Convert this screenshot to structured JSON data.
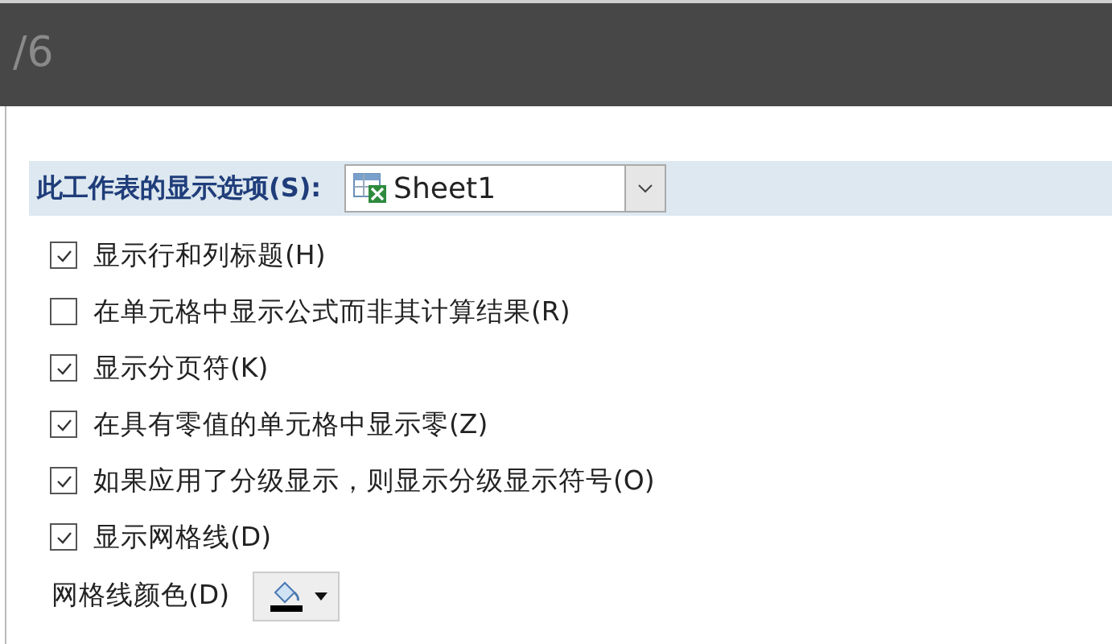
{
  "overlay_bar": {
    "page_label": "/6"
  },
  "sheet_options": {
    "title": "此工作表的显示选项(S):",
    "sheet": "Sheet1",
    "options": [
      {
        "label": "显示行和列标题(H)",
        "checked": true
      },
      {
        "label": "在单元格中显示公式而非其计算结果(R)",
        "checked": false
      },
      {
        "label": "显示分页符(K)",
        "checked": true
      },
      {
        "label": "在具有零值的单元格中显示零(Z)",
        "checked": true
      },
      {
        "label": "如果应用了分级显示，则显示分级显示符号(O)",
        "checked": true
      },
      {
        "label": "显示网格线(D)",
        "checked": true
      }
    ],
    "gridline_color": {
      "label": "网格线颜色(D)",
      "color": "#000000"
    }
  }
}
